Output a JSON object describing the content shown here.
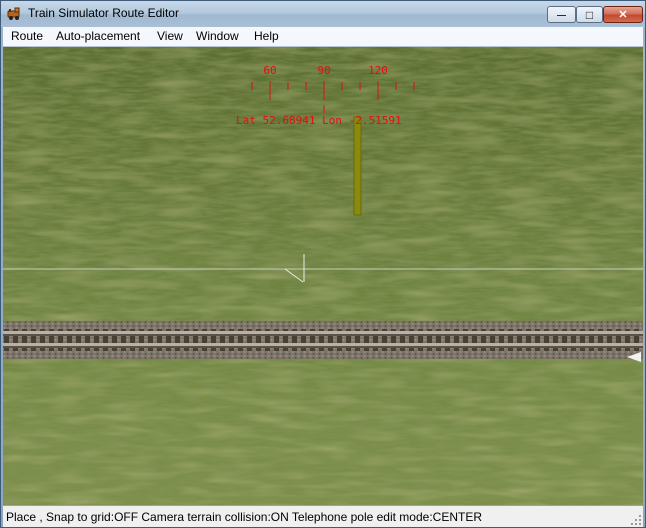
{
  "window": {
    "title": "Train Simulator Route Editor",
    "icons": {
      "app": "train-app-icon",
      "minimize": "minimize-icon",
      "maximize": "maximize-icon",
      "close": "close-icon"
    },
    "minimize_glyph": "—",
    "maximize_glyph": "□",
    "close_glyph": "✕"
  },
  "menu": {
    "items": [
      {
        "label": "Route"
      },
      {
        "label": "Auto-placement"
      },
      {
        "label": "View"
      },
      {
        "label": "Window"
      },
      {
        "label": "Help"
      }
    ]
  },
  "hud": {
    "compass_labels": [
      "60",
      "90",
      "120"
    ],
    "position_readout": "Lat 52.68941 Lon -2.51591",
    "color": "#e01010"
  },
  "scene": {
    "objects": [
      "telephone-pole",
      "railway-track",
      "camera-cursor"
    ],
    "pole_color": "#8a8a10",
    "grass_color": "#6f8340"
  },
  "status": {
    "text": "Place , Snap to grid:OFF Camera terrain collision:ON Telephone pole edit mode:CENTER"
  }
}
